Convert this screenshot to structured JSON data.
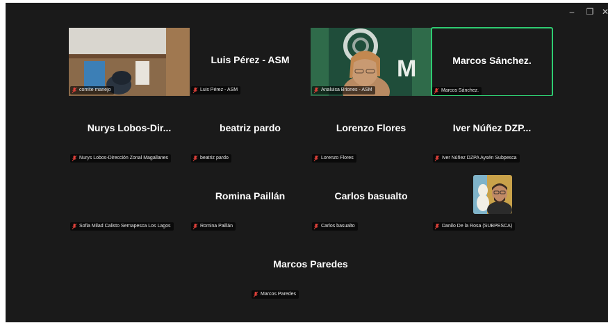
{
  "window": {
    "controls": {
      "minimize": "–",
      "restore": "❐",
      "close": "✕"
    }
  },
  "participants": [
    {
      "display_name": "",
      "label": "comite manejo",
      "has_video": true,
      "icon": "mic-muted-icon"
    },
    {
      "display_name": "Luis Pérez - ASM",
      "label": "Luis Pérez - ASM",
      "has_video": false,
      "icon": "mic-muted-icon"
    },
    {
      "display_name": "",
      "label": "Analuisa Briones - ASM",
      "has_video": true,
      "icon": "mic-muted-icon"
    },
    {
      "display_name": "Marcos Sánchez.",
      "label": "Marcos Sánchez.",
      "has_video": false,
      "active_speaker": true,
      "icon": "mic-muted-icon"
    },
    {
      "display_name": "Nurys  Lobos-Dir...",
      "label": "Nurys Lobos-Dirección Zonal Magallanes",
      "has_video": false,
      "icon": "mic-muted-icon"
    },
    {
      "display_name": "beatriz pardo",
      "label": "beatriz pardo",
      "has_video": false,
      "icon": "mic-muted-icon"
    },
    {
      "display_name": "Lorenzo Flores",
      "label": "Lorenzo Flores",
      "has_video": false,
      "icon": "mic-muted-icon"
    },
    {
      "display_name": "Iver Núñez DZP...",
      "label": "Iver Núñez DZPA Aysén Subpesca",
      "has_video": false,
      "icon": "mic-muted-icon"
    },
    {
      "display_name": "",
      "label": "Sofia Milad Calisto Sernapesca Los Lagos",
      "has_video": false,
      "icon": "mic-muted-icon"
    },
    {
      "display_name": "Romina Paillán",
      "label": "Romina Paillán",
      "has_video": false,
      "icon": "mic-muted-icon"
    },
    {
      "display_name": "Carlos  basualto",
      "label": "Carlos  basualto",
      "has_video": false,
      "icon": "mic-muted-icon"
    },
    {
      "display_name": "",
      "label": "Danilo De la Rosa (SUBPESCA)",
      "has_video": false,
      "has_avatar": true,
      "icon": "mic-muted-icon"
    },
    {
      "display_name": "Marcos Paredes",
      "label": "Marcos Paredes",
      "has_video": false,
      "icon": "mic-muted-icon"
    }
  ],
  "colors": {
    "background": "#1a1a1a",
    "active_border": "#2ecc71",
    "muted_icon": "#e0413a",
    "text": "#ffffff"
  }
}
